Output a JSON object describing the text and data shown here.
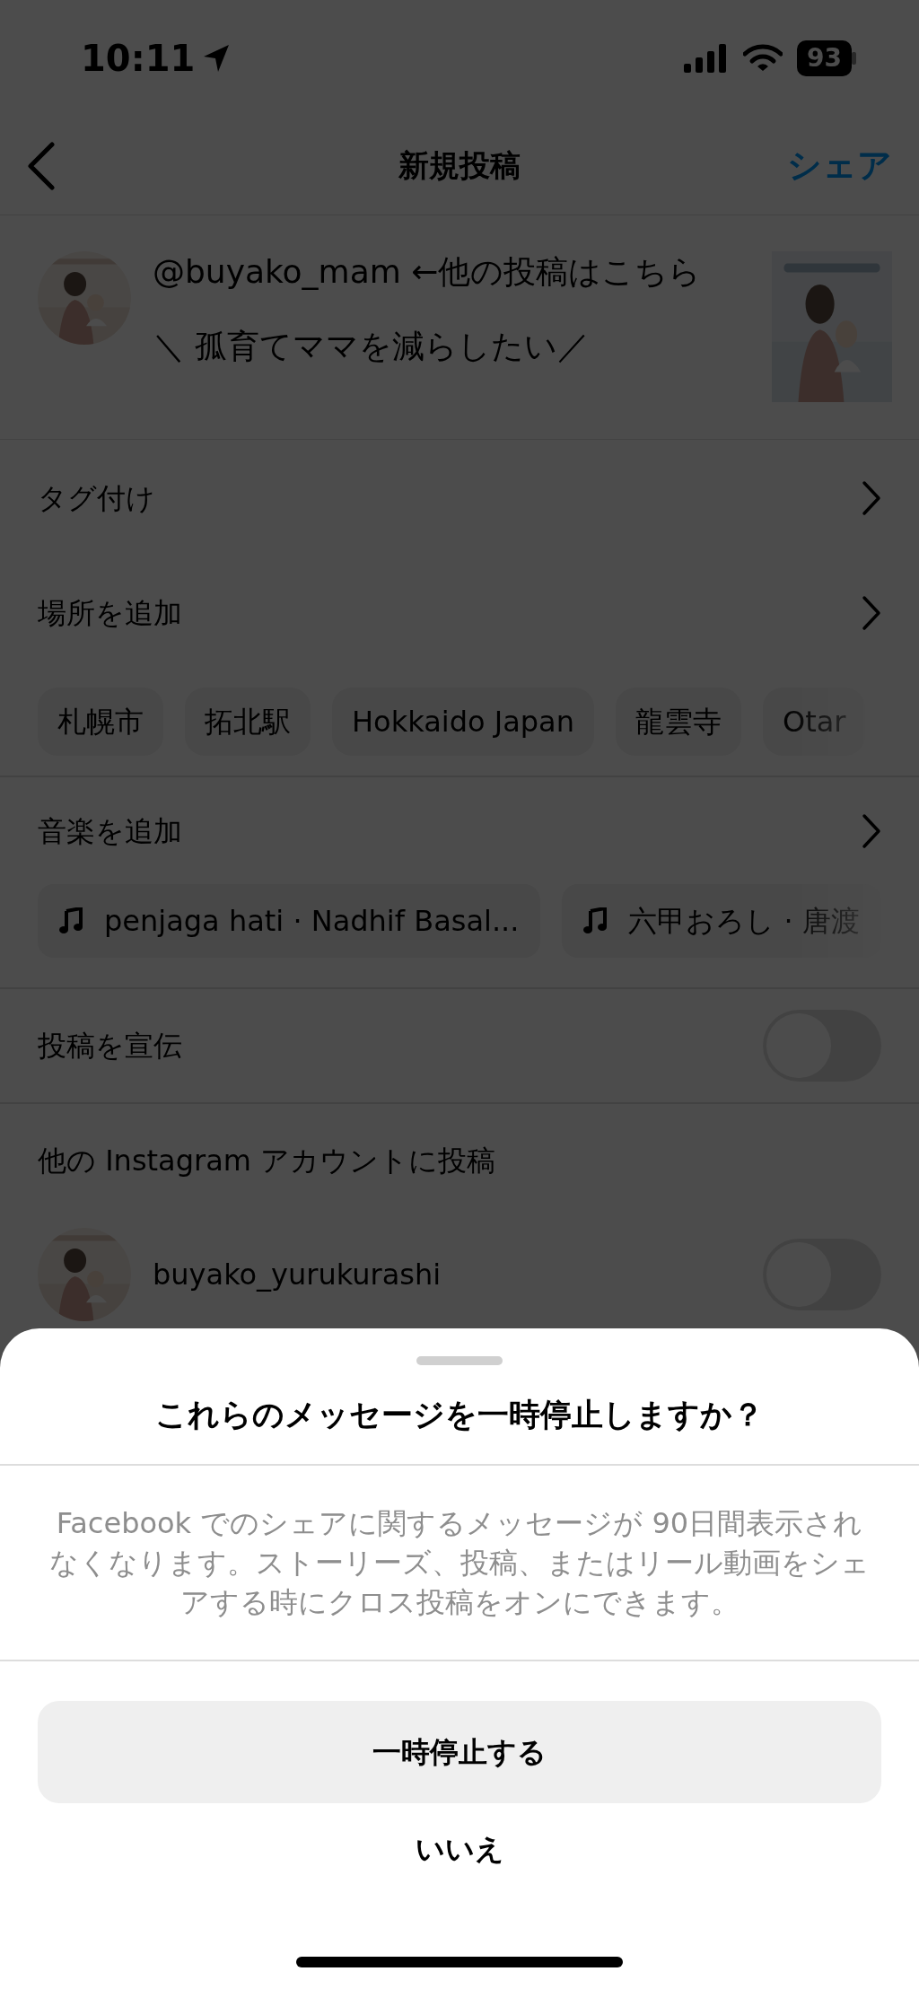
{
  "status_bar": {
    "time": "10:11",
    "battery": "93"
  },
  "header": {
    "title": "新規投稿",
    "action": "シェア"
  },
  "post": {
    "caption": [
      "@buyako_mam ←他の投稿はこちら",
      "＼ 孤育てママを減らしたい／"
    ]
  },
  "tagging": {
    "label": "タグ付け"
  },
  "location": {
    "label": "場所を追加",
    "suggestions": [
      "札幌市",
      "拓北駅",
      "Hokkaido Japan",
      "龍雲寺",
      "Otar"
    ]
  },
  "music": {
    "label": "音楽を追加",
    "suggestions": [
      "penjaga hati · Nadhif Basal...",
      "六甲おろし · 唐渡"
    ]
  },
  "promote": {
    "label": "投稿を宣伝",
    "on": false
  },
  "cross_post": {
    "heading": "他の Instagram アカウントに投稿",
    "accounts": [
      {
        "username": "buyako_yurukurashi",
        "on": false
      }
    ]
  },
  "dialog": {
    "title": "これらのメッセージを一時停止しますか？",
    "message": "Facebook でのシェアに関するメッセージが 90日間表示されなくなります。ストーリーズ、投稿、またはリール動画をシェアする時にクロス投稿をオンにできます。",
    "confirm": "一時停止する",
    "cancel": "いいえ"
  }
}
